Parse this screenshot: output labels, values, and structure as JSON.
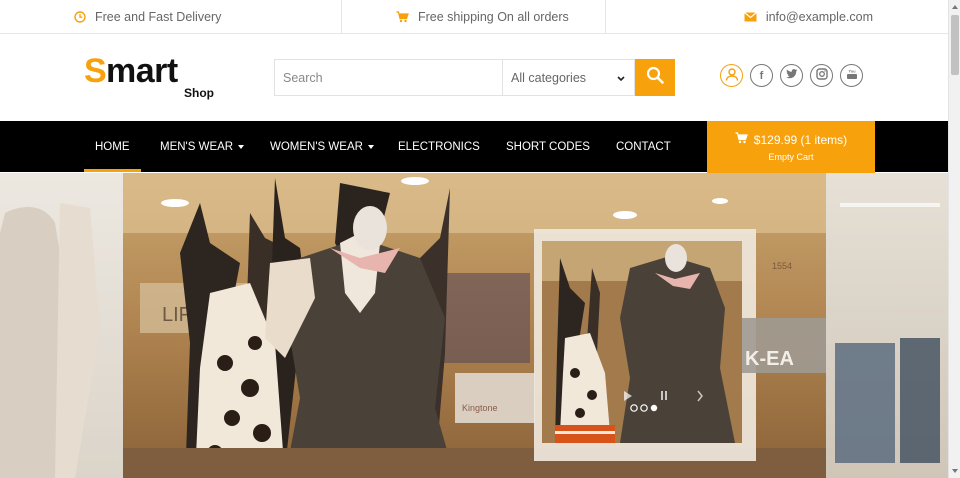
{
  "topbar": {
    "delivery": "Free and Fast Delivery",
    "shipping": "Free shipping On all orders",
    "email": "info@example.com"
  },
  "logo": {
    "s": "S",
    "mart": "mart",
    "shop": "Shop"
  },
  "search": {
    "placeholder": "Search",
    "category": "All categories"
  },
  "social": {
    "facebook": "f"
  },
  "nav": {
    "items": [
      {
        "label": "HOME"
      },
      {
        "label": "MEN'S WEAR"
      },
      {
        "label": "WOMEN'S WEAR"
      },
      {
        "label": "ELECTRONICS"
      },
      {
        "label": "SHORT CODES"
      },
      {
        "label": "CONTACT"
      }
    ]
  },
  "cart": {
    "summary": "$129.99 (1 items)",
    "action": "Empty Cart"
  },
  "hero": {
    "sign_left": "LIFT",
    "sign_right": "K-EA",
    "sign_number": "1554",
    "brand_text": "Kingtone"
  },
  "colors": {
    "accent": "#f7a10c",
    "nav_bg": "#000000"
  },
  "icons": [
    "clock-icon",
    "cart-icon",
    "envelope-icon",
    "search-icon",
    "user-icon",
    "facebook-icon",
    "twitter-icon",
    "instagram-icon",
    "youtube-icon"
  ]
}
